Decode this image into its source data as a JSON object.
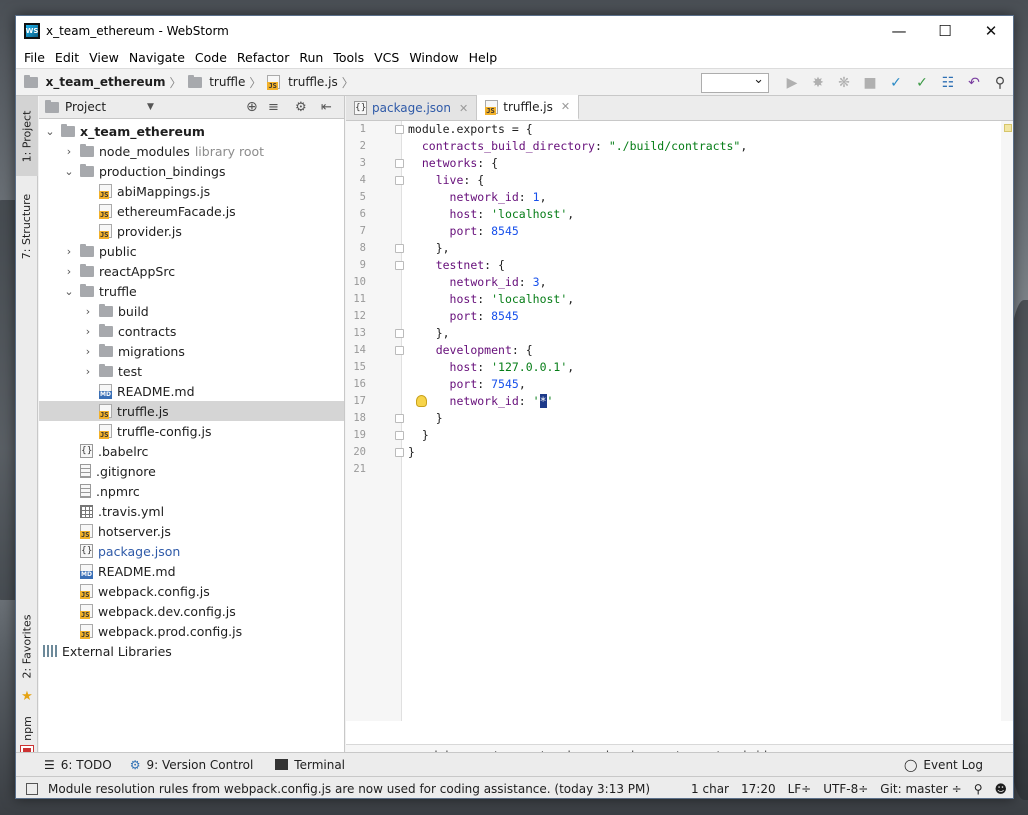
{
  "window": {
    "title": "x_team_ethereum - WebStorm"
  },
  "menu": [
    "File",
    "Edit",
    "View",
    "Navigate",
    "Code",
    "Refactor",
    "Run",
    "Tools",
    "VCS",
    "Window",
    "Help"
  ],
  "navbar": {
    "crumbs": [
      "x_team_ethereum",
      "truffle",
      "truffle.js"
    ]
  },
  "side_tabs": {
    "project": "1: Project",
    "structure": "7: Structure",
    "favorites": "2: Favorites",
    "npm": "npm"
  },
  "project_panel": {
    "title": "Project"
  },
  "tree": [
    {
      "label": "x_team_ethereum",
      "depth": 0,
      "arrow": "⌄",
      "icon": "folder",
      "bold": true
    },
    {
      "label": "node_modules",
      "extra": "library root",
      "depth": 1,
      "arrow": "›",
      "icon": "folder"
    },
    {
      "label": "production_bindings",
      "depth": 1,
      "arrow": "⌄",
      "icon": "folder"
    },
    {
      "label": "abiMappings.js",
      "depth": 2,
      "icon": "js"
    },
    {
      "label": "ethereumFacade.js",
      "depth": 2,
      "icon": "js"
    },
    {
      "label": "provider.js",
      "depth": 2,
      "icon": "js"
    },
    {
      "label": "public",
      "depth": 1,
      "arrow": "›",
      "icon": "folder"
    },
    {
      "label": "reactAppSrc",
      "depth": 1,
      "arrow": "›",
      "icon": "folder"
    },
    {
      "label": "truffle",
      "depth": 1,
      "arrow": "⌄",
      "icon": "folder"
    },
    {
      "label": "build",
      "depth": 2,
      "arrow": "›",
      "icon": "folder"
    },
    {
      "label": "contracts",
      "depth": 2,
      "arrow": "›",
      "icon": "folder"
    },
    {
      "label": "migrations",
      "depth": 2,
      "arrow": "›",
      "icon": "folder"
    },
    {
      "label": "test",
      "depth": 2,
      "arrow": "›",
      "icon": "folder"
    },
    {
      "label": "README.md",
      "depth": 2,
      "icon": "md"
    },
    {
      "label": "truffle.js",
      "depth": 2,
      "icon": "js",
      "selected": true
    },
    {
      "label": "truffle-config.js",
      "depth": 2,
      "icon": "js"
    },
    {
      "label": ".babelrc",
      "depth": 1,
      "icon": "brace"
    },
    {
      "label": ".gitignore",
      "depth": 1,
      "icon": "txt"
    },
    {
      "label": ".npmrc",
      "depth": 1,
      "icon": "txt"
    },
    {
      "label": ".travis.yml",
      "depth": 1,
      "icon": "grid"
    },
    {
      "label": "hotserver.js",
      "depth": 1,
      "icon": "js"
    },
    {
      "label": "package.json",
      "depth": 1,
      "icon": "brace",
      "blue": true
    },
    {
      "label": "README.md",
      "depth": 1,
      "icon": "md"
    },
    {
      "label": "webpack.config.js",
      "depth": 1,
      "icon": "js"
    },
    {
      "label": "webpack.dev.config.js",
      "depth": 1,
      "icon": "js"
    },
    {
      "label": "webpack.prod.config.js",
      "depth": 1,
      "icon": "js"
    },
    {
      "label": "External Libraries",
      "depth": 0,
      "icon": "lib",
      "noarrow": true
    }
  ],
  "tabs": [
    {
      "label": "package.json",
      "icon": "brace",
      "active": false
    },
    {
      "label": "truffle.js",
      "icon": "js",
      "active": true
    }
  ],
  "code": [
    {
      "n": "1",
      "t": [
        [
          "",
          "module.exports = {"
        ]
      ],
      "fold": true
    },
    {
      "n": "2",
      "t": [
        [
          "",
          "  "
        ],
        [
          "prop",
          "contracts_build_directory"
        ],
        [
          "",
          ": "
        ],
        [
          "str",
          "\"./build/contracts\""
        ],
        [
          "",
          ","
        ]
      ]
    },
    {
      "n": "3",
      "t": [
        [
          "",
          "  "
        ],
        [
          "prop",
          "networks"
        ],
        [
          "",
          ": {"
        ]
      ],
      "fold": true
    },
    {
      "n": "4",
      "t": [
        [
          "",
          "    "
        ],
        [
          "prop",
          "live"
        ],
        [
          "",
          ": {"
        ]
      ],
      "fold": true
    },
    {
      "n": "5",
      "t": [
        [
          "",
          "      "
        ],
        [
          "prop",
          "network_id"
        ],
        [
          "",
          ": "
        ],
        [
          "num",
          "1"
        ],
        [
          "",
          ","
        ]
      ]
    },
    {
      "n": "6",
      "t": [
        [
          "",
          "      "
        ],
        [
          "prop",
          "host"
        ],
        [
          "",
          ": "
        ],
        [
          "str",
          "'localhost'"
        ],
        [
          "",
          ","
        ]
      ]
    },
    {
      "n": "7",
      "t": [
        [
          "",
          "      "
        ],
        [
          "prop",
          "port"
        ],
        [
          "",
          ": "
        ],
        [
          "num",
          "8545"
        ]
      ]
    },
    {
      "n": "8",
      "t": [
        [
          "",
          "    },"
        ]
      ],
      "fold": true
    },
    {
      "n": "9",
      "t": [
        [
          "",
          "    "
        ],
        [
          "prop",
          "testnet"
        ],
        [
          "",
          ": {"
        ]
      ],
      "fold": true
    },
    {
      "n": "10",
      "t": [
        [
          "",
          "      "
        ],
        [
          "prop",
          "network_id"
        ],
        [
          "",
          ": "
        ],
        [
          "num",
          "3"
        ],
        [
          "",
          ","
        ]
      ]
    },
    {
      "n": "11",
      "t": [
        [
          "",
          "      "
        ],
        [
          "prop",
          "host"
        ],
        [
          "",
          ": "
        ],
        [
          "str",
          "'localhost'"
        ],
        [
          "",
          ","
        ]
      ]
    },
    {
      "n": "12",
      "t": [
        [
          "",
          "      "
        ],
        [
          "prop",
          "port"
        ],
        [
          "",
          ": "
        ],
        [
          "num",
          "8545"
        ]
      ]
    },
    {
      "n": "13",
      "t": [
        [
          "",
          "    },"
        ]
      ],
      "fold": true
    },
    {
      "n": "14",
      "t": [
        [
          "",
          "    "
        ],
        [
          "prop",
          "development"
        ],
        [
          "",
          ": {"
        ]
      ],
      "fold": true
    },
    {
      "n": "15",
      "t": [
        [
          "",
          "      "
        ],
        [
          "prop",
          "host"
        ],
        [
          "",
          ": "
        ],
        [
          "str",
          "'127.0.0.1'"
        ],
        [
          "",
          ","
        ]
      ]
    },
    {
      "n": "16",
      "t": [
        [
          "",
          "      "
        ],
        [
          "prop",
          "port"
        ],
        [
          "",
          ": "
        ],
        [
          "num",
          "7545"
        ],
        [
          "",
          ","
        ]
      ]
    },
    {
      "n": "17",
      "t": [
        [
          "",
          "      "
        ],
        [
          "prop",
          "network_id"
        ],
        [
          "",
          ": "
        ],
        [
          "str",
          "'"
        ],
        [
          "cur",
          "*"
        ],
        [
          "str",
          "'"
        ]
      ],
      "bulb": true
    },
    {
      "n": "18",
      "t": [
        [
          "",
          "    }"
        ]
      ],
      "fold": true
    },
    {
      "n": "19",
      "t": [
        [
          "",
          "  }"
        ]
      ],
      "fold": true
    },
    {
      "n": "20",
      "t": [
        [
          "",
          "}"
        ]
      ],
      "fold": true
    },
    {
      "n": "21",
      "t": [
        [
          "",
          ""
        ]
      ]
    }
  ],
  "code_breadcrumbs": [
    "module.exports",
    "networks",
    "development",
    "network_id"
  ],
  "bottom_tools": {
    "todo": "6: TODO",
    "vcs": "9: Version Control",
    "terminal": "Terminal",
    "eventlog": "Event Log"
  },
  "status": {
    "message": "Module resolution rules from webpack.config.js are now used for coding assistance. (today 3:13 PM)",
    "chars": "1 char",
    "pos": "17:20",
    "lf": "LF÷",
    "enc": "UTF-8÷",
    "git": "Git: master ÷"
  }
}
